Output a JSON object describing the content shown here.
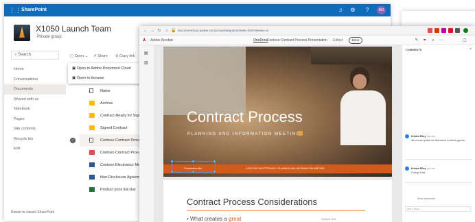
{
  "sharepoint": {
    "brand": "SharePoint",
    "avatar_initials": "MD",
    "site_title": "X1050 Launch Team",
    "site_subtitle": "Private group",
    "search_placeholder": "Search",
    "nav": [
      "Home",
      "Conversations",
      "Documents",
      "Shared with us",
      "Notebook",
      "Pages",
      "Site contents",
      "Recycle bin",
      "Edit"
    ],
    "active_nav": "Documents",
    "return_link": "Return to classic SharePoint",
    "commands": {
      "open": "Open",
      "share": "Share",
      "copy_link": "Copy link"
    },
    "open_menu": {
      "item1": "Open in Adobe Document Cloud",
      "item2": "Open in browser"
    },
    "list_header": "Name",
    "files": [
      {
        "name": "Archive",
        "type": "folder"
      },
      {
        "name": "Contract Ready for Signing",
        "type": "folder"
      },
      {
        "name": "Signed Contract",
        "type": "folder"
      },
      {
        "name": "Contoso Contract Process",
        "type": "pdf",
        "selected": true
      },
      {
        "name": "Contoso Contract Process",
        "type": "pdf"
      },
      {
        "name": "Contoso Electronics Marketing",
        "type": "word"
      },
      {
        "name": "Non-Disclosure Agreement",
        "type": "word"
      },
      {
        "name": "Product price list.xlsx",
        "type": "excel"
      }
    ]
  },
  "acrobat": {
    "url": "documentcloud.adobe.com/proxy/integration/index.html?viewer=ui",
    "app_name": "Adobe Acrobat",
    "onedrive_label": "OneDrive",
    "doc_title": "Contoso Contract Process Presentation",
    "edited_label": "Edited",
    "done_label": "Done",
    "slide1": {
      "title": "Contract Process",
      "subtitle": "PLANNING AND INFORMATION MEETING",
      "band_left": "Presentation title",
      "band_right": "CONTOSO ELECTRONICS • PLANNING AND INFORMATION MEETING"
    },
    "slide2": {
      "title": "Contract Process Considerations",
      "bullet_prefix": "What creates a ",
      "bullet_accent": "great",
      "small": "Sample text"
    },
    "comments": {
      "header": "COMMENTS",
      "items": [
        {
          "author": "Kristen Riley",
          "time": "just now",
          "body": "We should update the title based on latest agenda."
        },
        {
          "author": "Kristen Riley",
          "time": "just now",
          "body": "Change Date"
        }
      ],
      "show_more": "Show comments",
      "reply_placeholder": "Add a reply..."
    }
  },
  "colors": {
    "sp_blue": "#0f6cbd",
    "accent_orange": "#d25a1a",
    "adobe_red": "#b30b00"
  }
}
